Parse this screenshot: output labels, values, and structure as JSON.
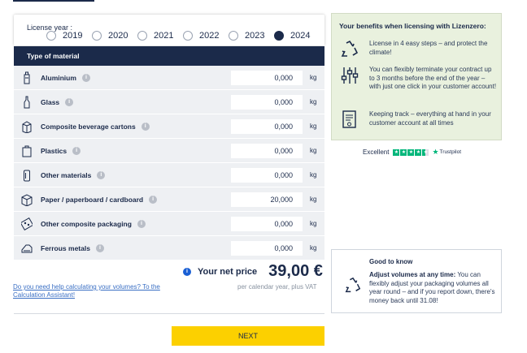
{
  "license": {
    "label": "License year :",
    "years": [
      {
        "label": "2019",
        "checked": false
      },
      {
        "label": "2020",
        "checked": false
      },
      {
        "label": "2021",
        "checked": false
      },
      {
        "label": "2022",
        "checked": false
      },
      {
        "label": "2023",
        "checked": false
      },
      {
        "label": "2024",
        "checked": true
      }
    ]
  },
  "table": {
    "header": "Type of material",
    "unit": "kg",
    "rows": [
      {
        "label": "Aluminium",
        "value": "0,000",
        "icon": "spray-can-icon"
      },
      {
        "label": "Glass",
        "value": "0,000",
        "icon": "bottle-icon"
      },
      {
        "label": "Composite beverage cartons",
        "value": "0,000",
        "icon": "carton-icon"
      },
      {
        "label": "Plastics",
        "value": "0,000",
        "icon": "plastic-bag-icon"
      },
      {
        "label": "Other materials",
        "value": "0,000",
        "icon": "can-icon"
      },
      {
        "label": "Paper / paperboard / cardboard",
        "value": "20,000",
        "icon": "box-icon"
      },
      {
        "label": "Other composite packaging",
        "value": "0,000",
        "icon": "blister-pack-icon"
      },
      {
        "label": "Ferrous metals",
        "value": "0,000",
        "icon": "tin-can-icon"
      }
    ]
  },
  "price": {
    "label": "Your net price",
    "value": "39,00 €",
    "sub": "per calendar year, plus VAT"
  },
  "help_link": "Do you need help calculating your volumes? To the Calculation Assistant!",
  "next_label": "NEXT",
  "benefits": {
    "title": "Your benefits when licensing with Lizenzero:",
    "items": [
      {
        "text": "License in 4 easy steps – and protect the climate!",
        "icon": "recycle-icon"
      },
      {
        "text": "You can flexibly terminate your contract up to 3 months before the end of the year – with just one click in your customer account!",
        "icon": "sliders-icon"
      },
      {
        "text": "Keeping track – everything at hand in your customer account at all times",
        "icon": "document-icon"
      }
    ]
  },
  "trustpilot": {
    "rating_word": "Excellent",
    "brand": "Trustpilot",
    "stars": 4.5
  },
  "good_to_know": {
    "title": "Good to know",
    "bold": "Adjust volumes at any time:",
    "text": " You can flexibly adjust your packaging volumes all year round – and if you report down, there's money back until 31.08!"
  },
  "colors": {
    "navy": "#1b2a4a",
    "accent_yellow": "#fcd000",
    "benefit_bg": "#e9f1de",
    "trustpilot_green": "#00b67a"
  }
}
